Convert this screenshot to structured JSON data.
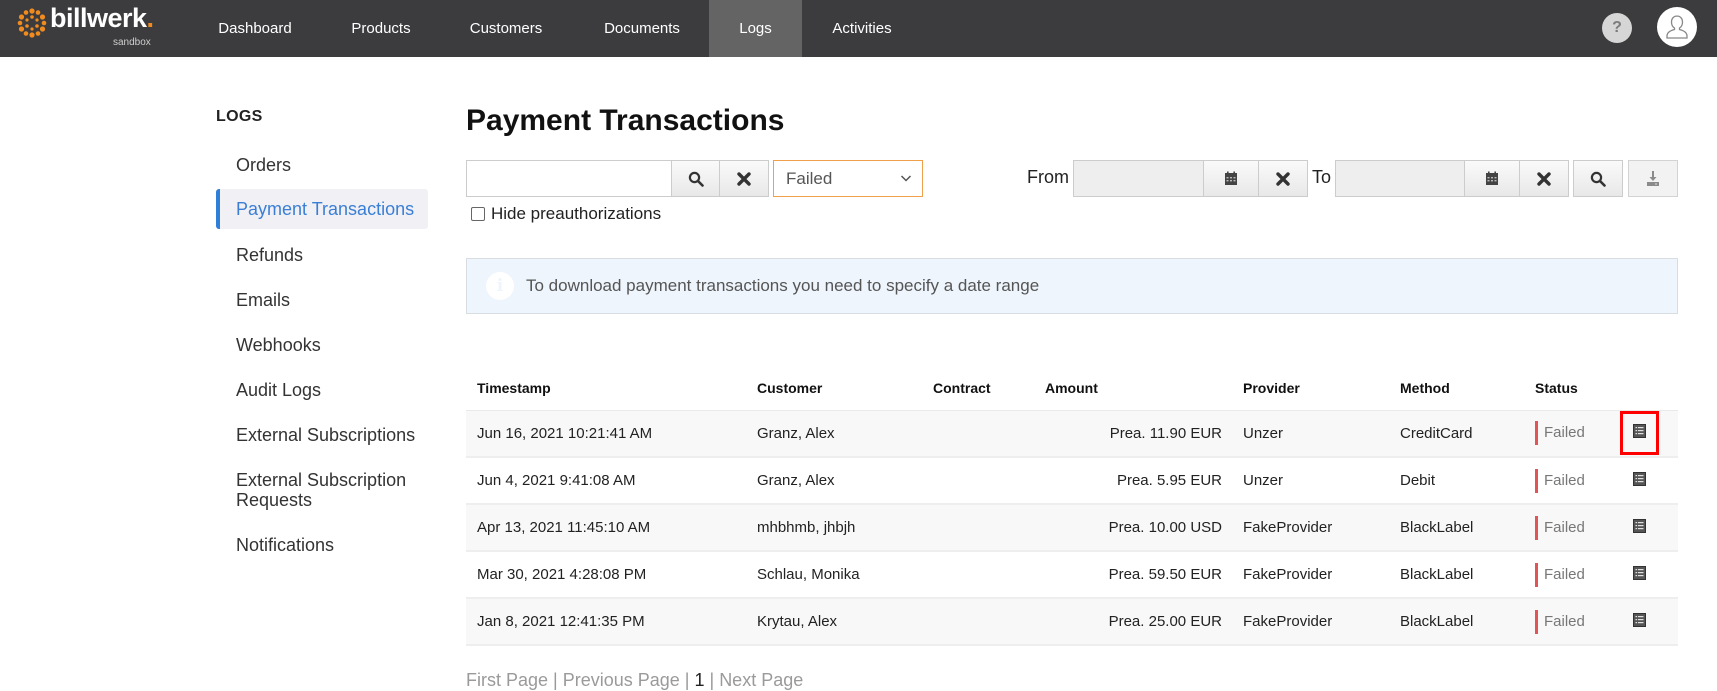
{
  "app": {
    "brand": "billwerk",
    "brand_dot": ".",
    "environment": "sandbox"
  },
  "nav": {
    "items": [
      {
        "label": "Dashboard",
        "active": false
      },
      {
        "label": "Products",
        "active": false
      },
      {
        "label": "Customers",
        "active": false
      },
      {
        "label": "Documents",
        "active": false
      },
      {
        "label": "Logs",
        "active": true
      },
      {
        "label": "Activities",
        "active": false
      }
    ],
    "help_label": "?",
    "help_icon": "question-icon",
    "avatar_icon": "user-icon"
  },
  "sidebar": {
    "title": "LOGS",
    "items": [
      {
        "label": "Orders",
        "active": false
      },
      {
        "label": "Payment Transactions",
        "active": true
      },
      {
        "label": "Refunds",
        "active": false
      },
      {
        "label": "Emails",
        "active": false
      },
      {
        "label": "Webhooks",
        "active": false
      },
      {
        "label": "Audit Logs",
        "active": false
      },
      {
        "label": "External Subscriptions",
        "active": false
      },
      {
        "label": "External Subscription Requests",
        "active": false
      },
      {
        "label": "Notifications",
        "active": false
      }
    ]
  },
  "page": {
    "title": "Payment Transactions"
  },
  "filters": {
    "search_value": "",
    "search_placeholder": "",
    "status_selected": "Failed",
    "from_label": "From",
    "from_value": "",
    "to_label": "To",
    "to_value": "",
    "hide_preauth_label": "Hide preauthorizations",
    "hide_preauth_checked": false
  },
  "info": {
    "icon": "info-icon",
    "icon_glyph": "i",
    "message": "To download payment transactions you need to specify a date range"
  },
  "table": {
    "columns": [
      "Timestamp",
      "Customer",
      "Contract",
      "Amount",
      "Provider",
      "Method",
      "Status"
    ],
    "rows": [
      {
        "timestamp": "Jun 16, 2021 10:21:41 AM",
        "customer": "Granz, Alex",
        "contract": "",
        "amount": "Prea. 11.90 EUR",
        "provider": "Unzer",
        "method": "CreditCard",
        "status": "Failed"
      },
      {
        "timestamp": "Jun 4, 2021 9:41:08 AM",
        "customer": "Granz, Alex",
        "contract": "",
        "amount": "Prea. 5.95 EUR",
        "provider": "Unzer",
        "method": "Debit",
        "status": "Failed"
      },
      {
        "timestamp": "Apr 13, 2021 11:45:10 AM",
        "customer": "mhbhmb, jhbjh",
        "contract": "",
        "amount": "Prea. 10.00 USD",
        "provider": "FakeProvider",
        "method": "BlackLabel",
        "status": "Failed"
      },
      {
        "timestamp": "Mar 30, 2021 4:28:08 PM",
        "customer": "Schlau, Monika",
        "contract": "",
        "amount": "Prea. 59.50 EUR",
        "provider": "FakeProvider",
        "method": "BlackLabel",
        "status": "Failed"
      },
      {
        "timestamp": "Jan 8, 2021 12:41:35 PM",
        "customer": "Krytau, Alex",
        "contract": "",
        "amount": "Prea. 25.00 EUR",
        "provider": "FakeProvider",
        "method": "BlackLabel",
        "status": "Failed"
      }
    ]
  },
  "pagination": {
    "first": "First Page",
    "previous": "Previous Page",
    "current": "1",
    "next": "Next Page",
    "separator": " | "
  },
  "colors": {
    "nav_bg": "#3c3c3e",
    "nav_active": "#646464",
    "brand_orange": "#f28b1e",
    "accent_blue": "#2f7ed8",
    "status_failed": "#e05555",
    "select_border": "#f0a04b",
    "highlight": "#ff0000"
  }
}
